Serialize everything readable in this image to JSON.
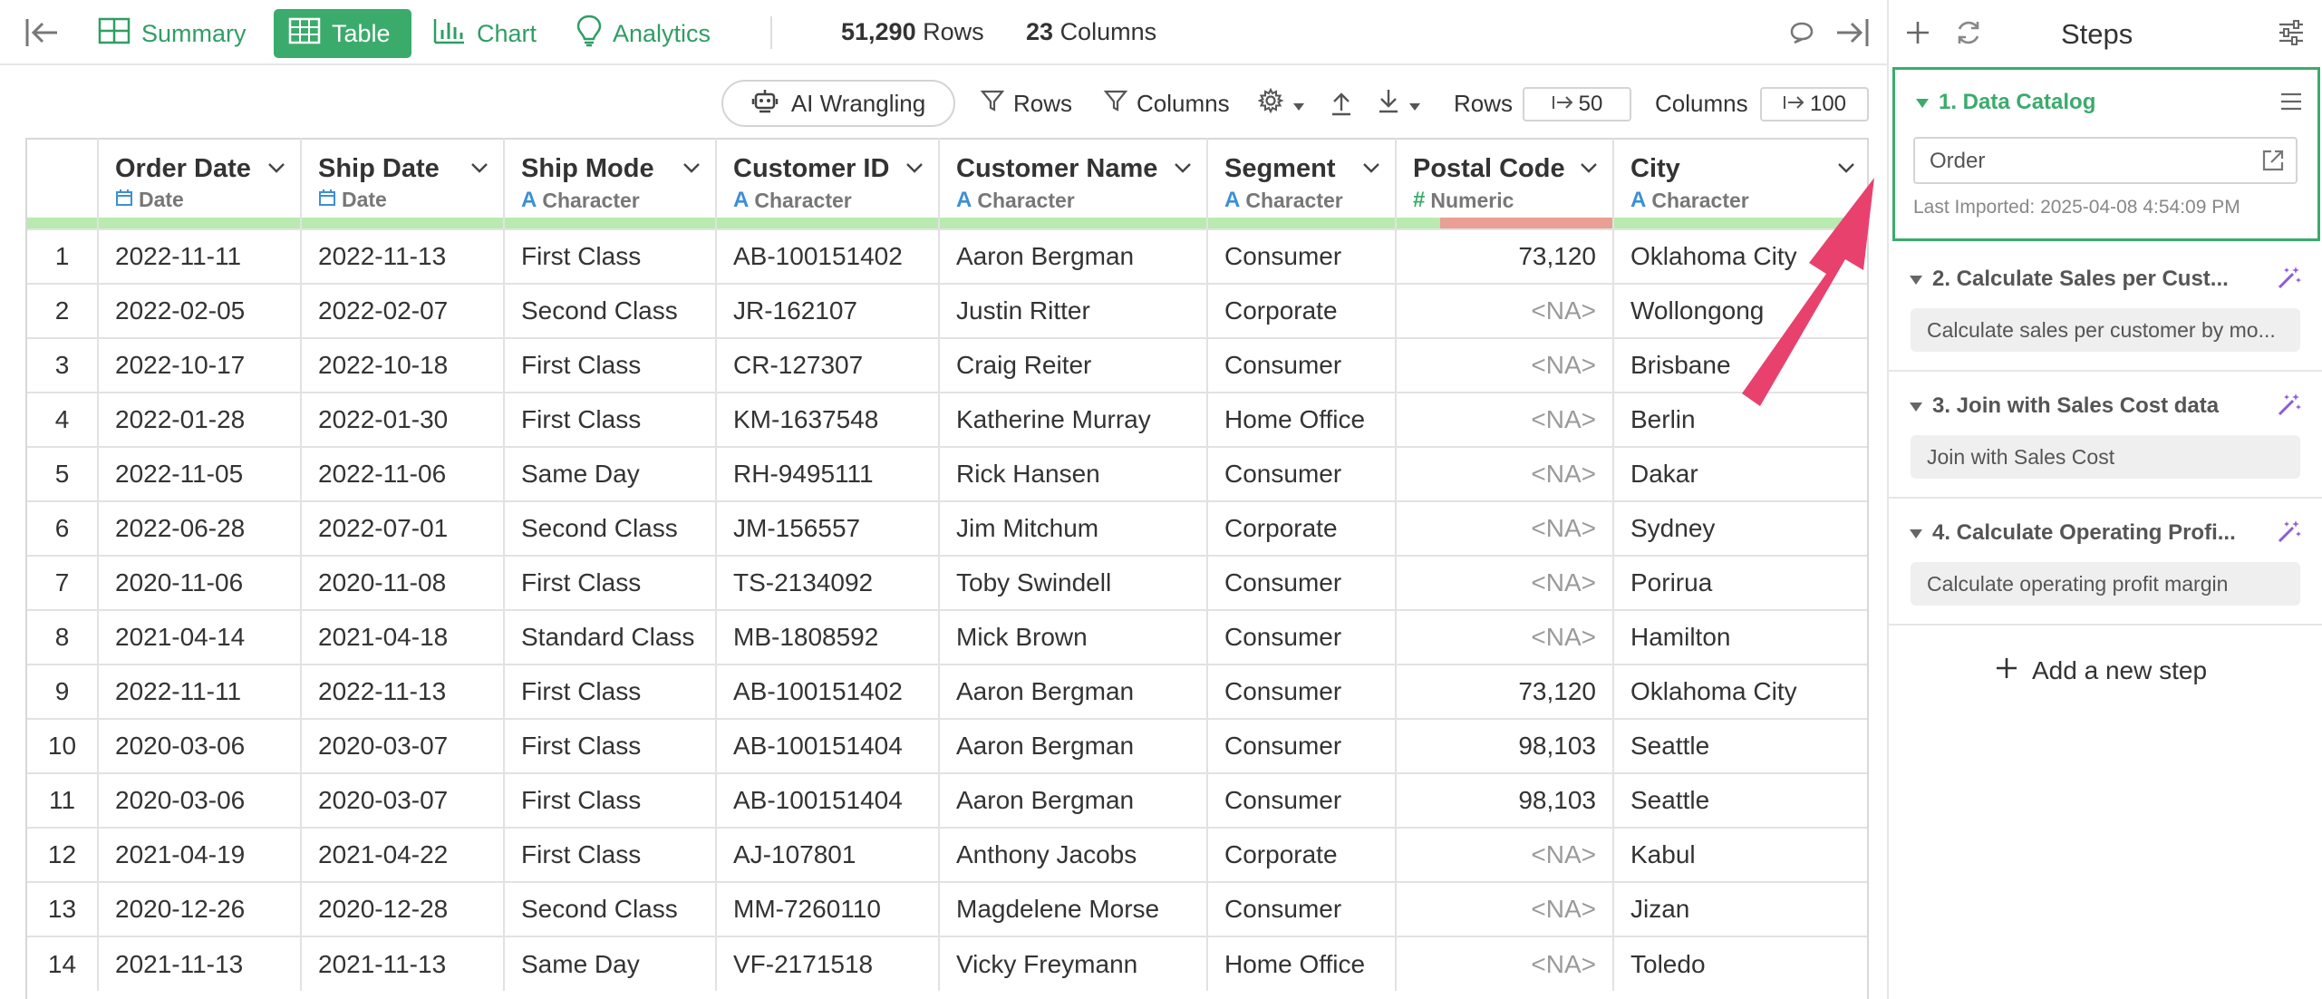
{
  "toolbar": {
    "tabs": [
      {
        "label": "Summary",
        "icon": "summary-grid-icon"
      },
      {
        "label": "Table",
        "icon": "table-icon",
        "active": true
      },
      {
        "label": "Chart",
        "icon": "bar-chart-icon"
      },
      {
        "label": "Analytics",
        "icon": "lightbulb-icon"
      }
    ],
    "rows_count": "51,290",
    "rows_word": "Rows",
    "cols_count": "23",
    "cols_word": "Columns"
  },
  "subtoolbar": {
    "ai_label": "AI Wrangling",
    "rows_filter": "Rows",
    "columns_filter": "Columns",
    "rows_label": "Rows",
    "rows_value": "50",
    "columns_label": "Columns",
    "columns_value": "100"
  },
  "table": {
    "columns": [
      {
        "name": "Order Date",
        "type": "Date"
      },
      {
        "name": "Ship Date",
        "type": "Date"
      },
      {
        "name": "Ship Mode",
        "type": "Character"
      },
      {
        "name": "Customer ID",
        "type": "Character"
      },
      {
        "name": "Customer Name",
        "type": "Character"
      },
      {
        "name": "Segment",
        "type": "Character"
      },
      {
        "name": "Postal Code",
        "type": "Numeric"
      },
      {
        "name": "City",
        "type": "Character"
      }
    ],
    "rows": [
      [
        "1",
        "2022-11-11",
        "2022-11-13",
        "First Class",
        "AB-100151402",
        "Aaron Bergman",
        "Consumer",
        "73,120",
        "Oklahoma City"
      ],
      [
        "2",
        "2022-02-05",
        "2022-02-07",
        "Second Class",
        "JR-162107",
        "Justin Ritter",
        "Corporate",
        "<NA>",
        "Wollongong"
      ],
      [
        "3",
        "2022-10-17",
        "2022-10-18",
        "First Class",
        "CR-127307",
        "Craig Reiter",
        "Consumer",
        "<NA>",
        "Brisbane"
      ],
      [
        "4",
        "2022-01-28",
        "2022-01-30",
        "First Class",
        "KM-1637548",
        "Katherine Murray",
        "Home Office",
        "<NA>",
        "Berlin"
      ],
      [
        "5",
        "2022-11-05",
        "2022-11-06",
        "Same Day",
        "RH-9495111",
        "Rick Hansen",
        "Consumer",
        "<NA>",
        "Dakar"
      ],
      [
        "6",
        "2022-06-28",
        "2022-07-01",
        "Second Class",
        "JM-156557",
        "Jim Mitchum",
        "Corporate",
        "<NA>",
        "Sydney"
      ],
      [
        "7",
        "2020-11-06",
        "2020-11-08",
        "First Class",
        "TS-2134092",
        "Toby Swindell",
        "Consumer",
        "<NA>",
        "Porirua"
      ],
      [
        "8",
        "2021-04-14",
        "2021-04-18",
        "Standard Class",
        "MB-1808592",
        "Mick Brown",
        "Consumer",
        "<NA>",
        "Hamilton"
      ],
      [
        "9",
        "2022-11-11",
        "2022-11-13",
        "First Class",
        "AB-100151402",
        "Aaron Bergman",
        "Consumer",
        "73,120",
        "Oklahoma City"
      ],
      [
        "10",
        "2020-03-06",
        "2020-03-07",
        "First Class",
        "AB-100151404",
        "Aaron Bergman",
        "Consumer",
        "98,103",
        "Seattle"
      ],
      [
        "11",
        "2020-03-06",
        "2020-03-07",
        "First Class",
        "AB-100151404",
        "Aaron Bergman",
        "Consumer",
        "98,103",
        "Seattle"
      ],
      [
        "12",
        "2021-04-19",
        "2021-04-22",
        "First Class",
        "AJ-107801",
        "Anthony Jacobs",
        "Corporate",
        "<NA>",
        "Kabul"
      ],
      [
        "13",
        "2020-12-26",
        "2020-12-28",
        "Second Class",
        "MM-7260110",
        "Magdelene Morse",
        "Consumer",
        "<NA>",
        "Jizan"
      ],
      [
        "14",
        "2021-11-13",
        "2021-11-13",
        "Same Day",
        "VF-2171518",
        "Vicky Freymann",
        "Home Office",
        "<NA>",
        "Toledo"
      ]
    ]
  },
  "steps": {
    "title": "Steps",
    "items": [
      {
        "title": "1. Data Catalog",
        "source": "Order",
        "last_imported": "Last Imported: 2025-04-08 4:54:09 PM"
      },
      {
        "title": "2. Calculate Sales per Cust...",
        "desc": "Calculate sales per customer by mo..."
      },
      {
        "title": "3. Join with Sales Cost data",
        "desc": "Join with Sales Cost"
      },
      {
        "title": "4. Calculate Operating Profi...",
        "desc": "Calculate operating profit margin"
      }
    ],
    "add_label": "Add a new step"
  },
  "colors": {
    "brand_green": "#3bab6c",
    "accent_blue": "#3c8fd6",
    "arrow_pink": "#e8416e",
    "wand_purple": "#8a5cd6"
  }
}
